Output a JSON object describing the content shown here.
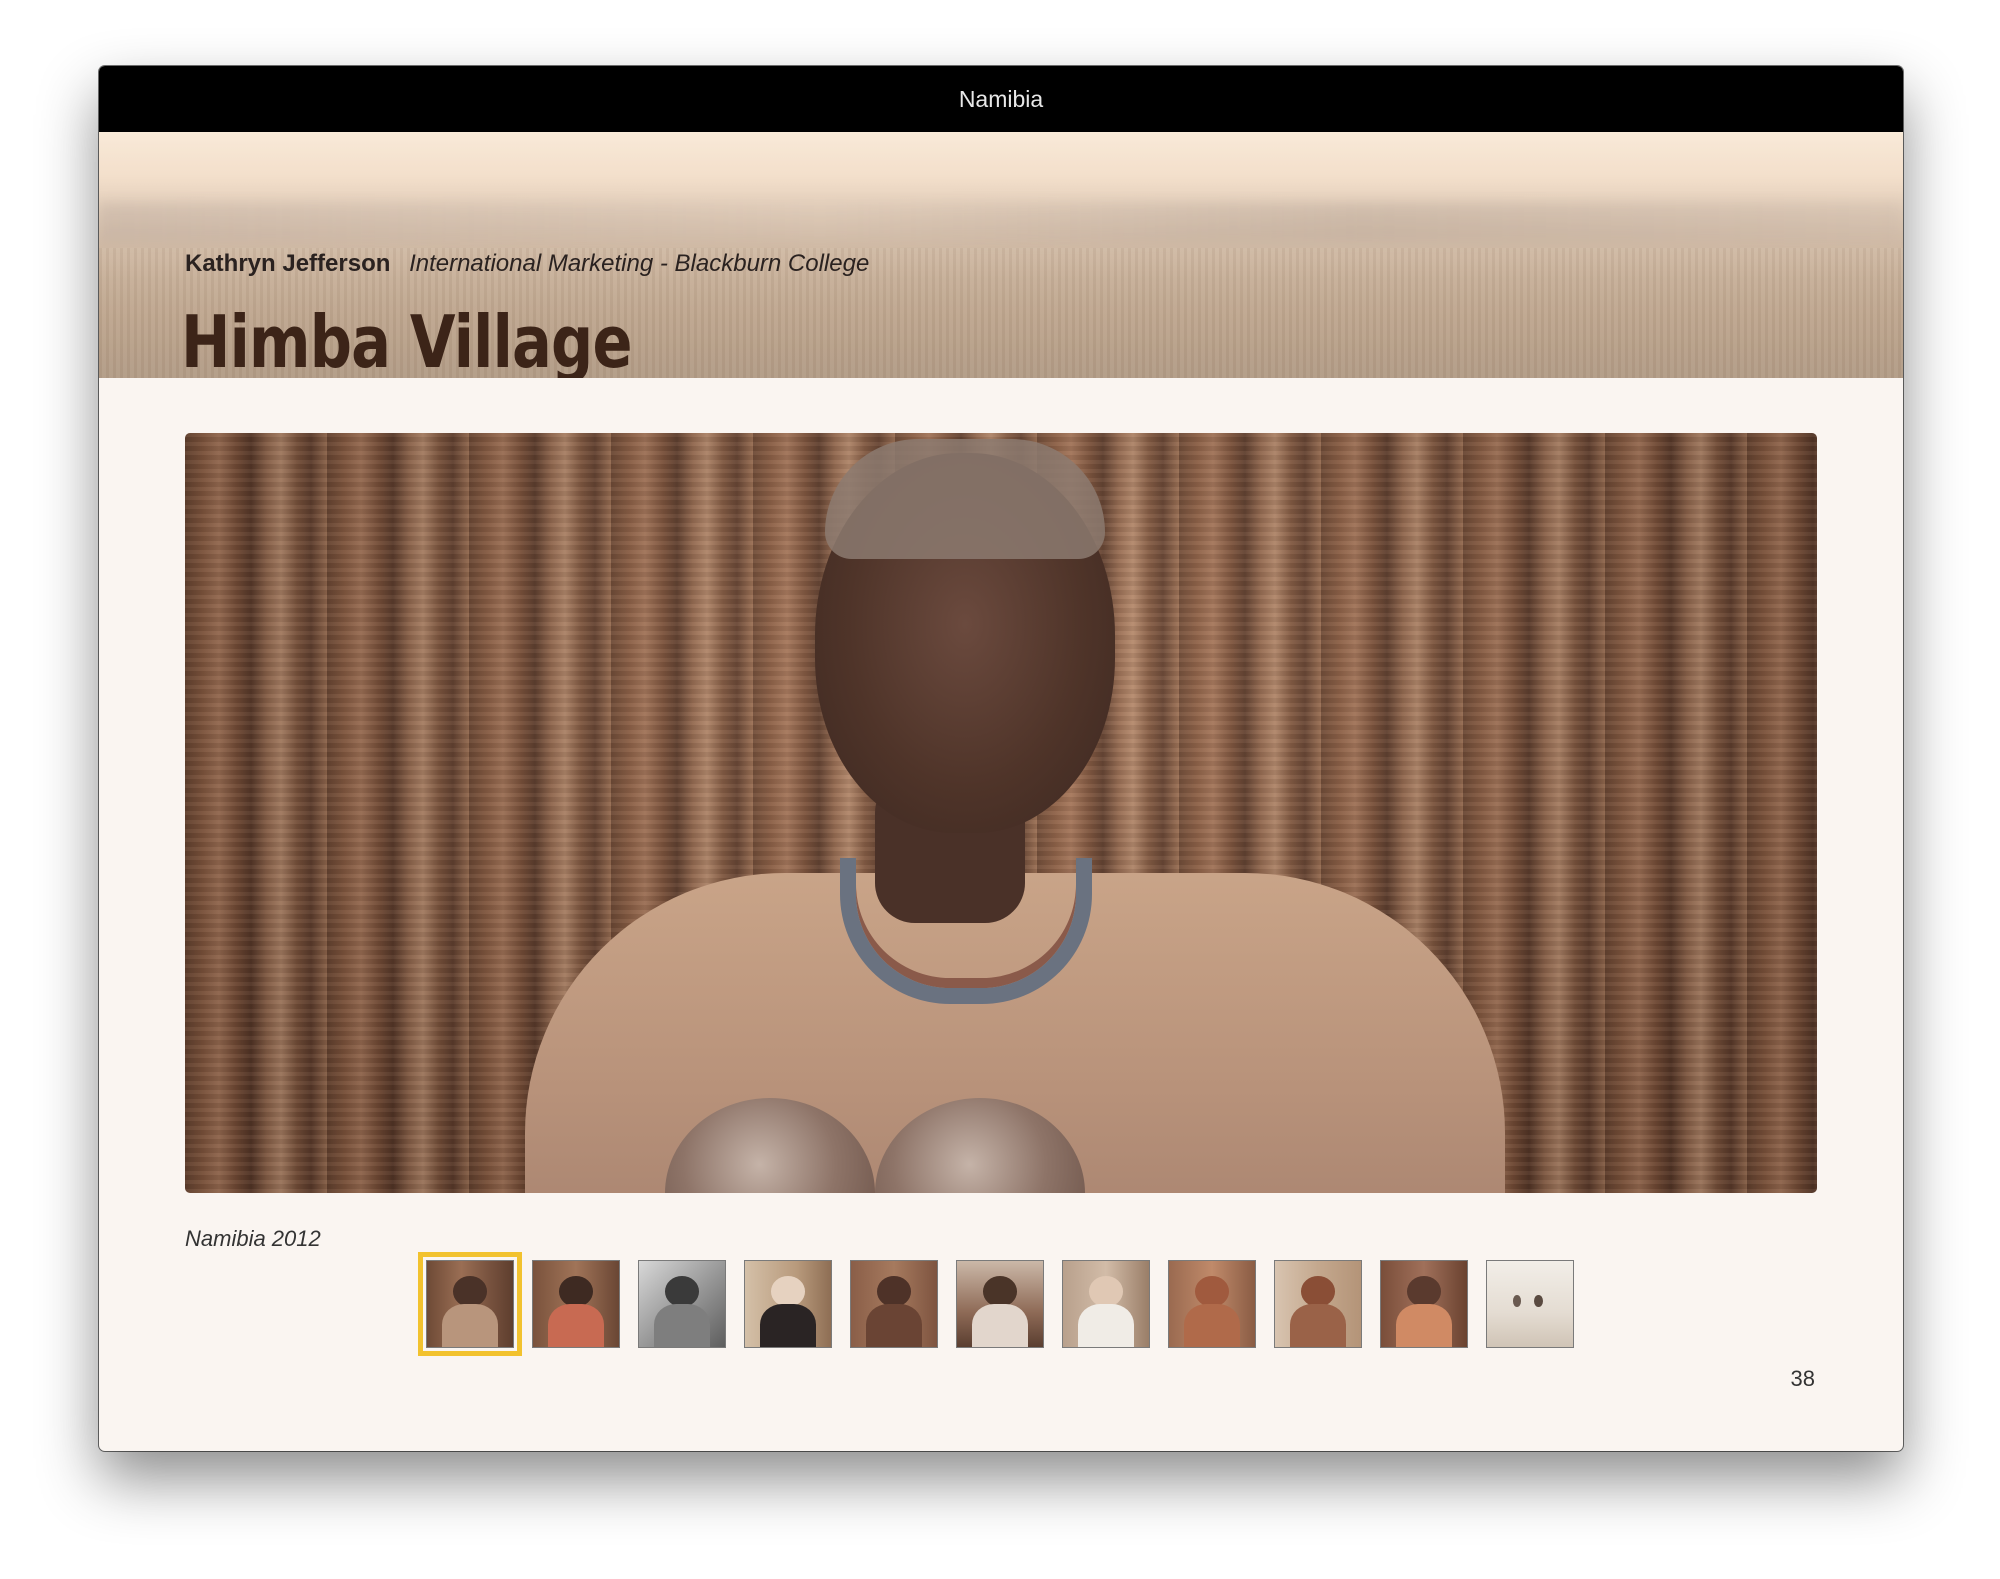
{
  "window": {
    "title": "Namibia"
  },
  "header": {
    "author_name": "Kathryn Jefferson",
    "course": "International Marketing - Blackburn College",
    "page_title": "Himba Village"
  },
  "photo": {
    "caption": "Namibia 2012"
  },
  "gallery": {
    "selected_index": 0,
    "thumbnail_count": 11
  },
  "footer": {
    "page_number": "38"
  }
}
